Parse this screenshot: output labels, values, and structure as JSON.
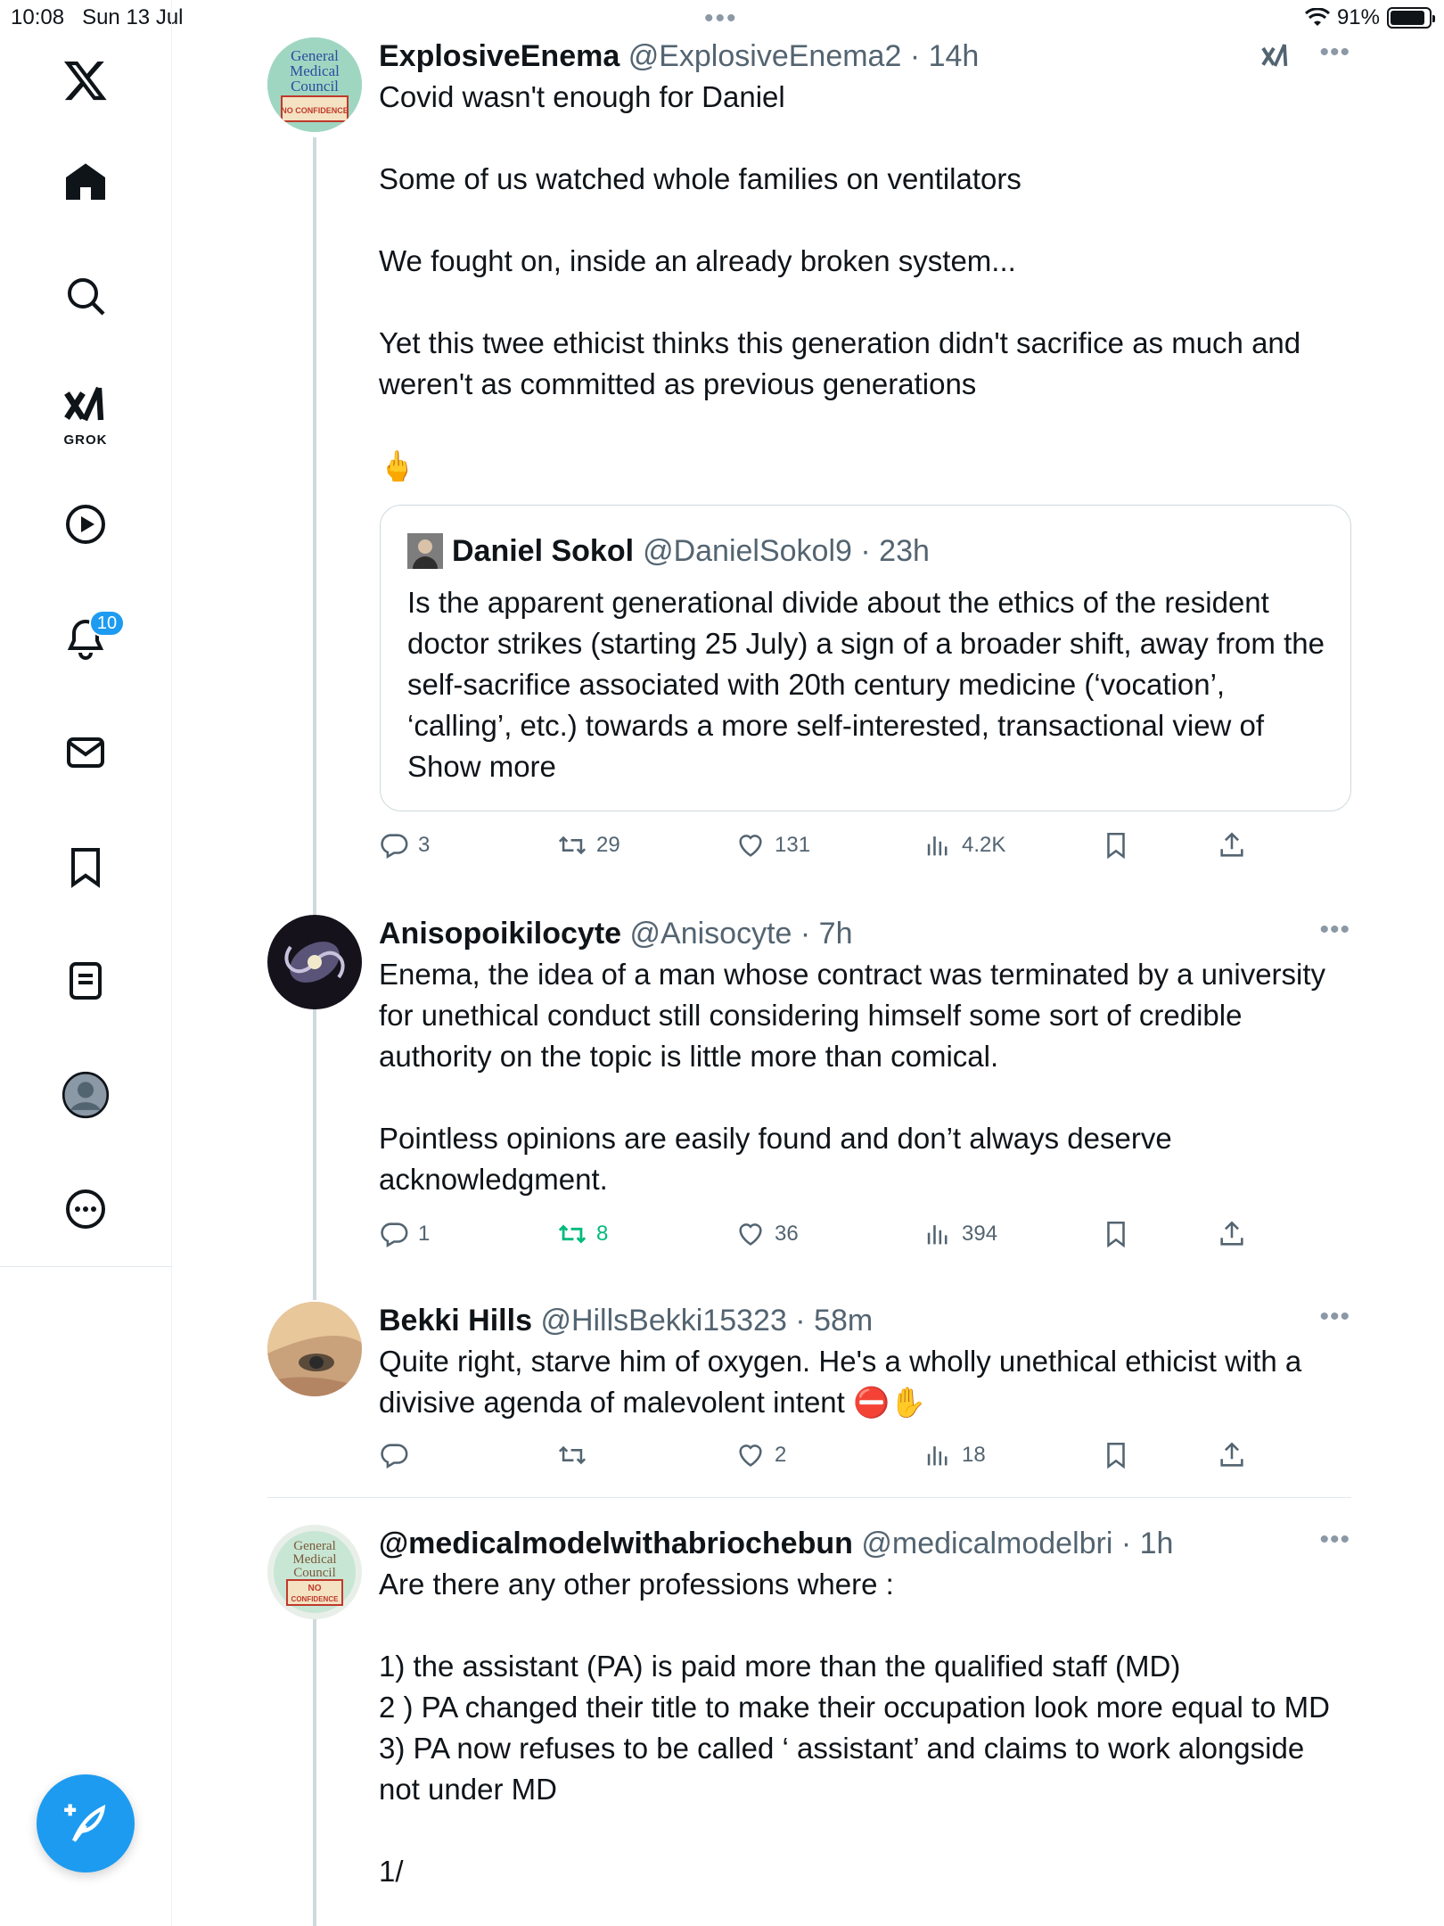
{
  "status_bar": {
    "time": "10:08",
    "date": "Sun 13 Jul",
    "battery": "91%"
  },
  "sidebar": {
    "items": [
      {
        "icon": "x-logo-icon"
      },
      {
        "icon": "home-icon"
      },
      {
        "icon": "search-icon"
      },
      {
        "icon": "grok-icon",
        "label": "GROK"
      },
      {
        "icon": "video-icon"
      },
      {
        "icon": "notifications-icon",
        "badge": "10"
      },
      {
        "icon": "messages-icon"
      },
      {
        "icon": "bookmarks-icon"
      },
      {
        "icon": "lists-icon"
      },
      {
        "icon": "profile-icon"
      },
      {
        "icon": "more-icon"
      }
    ],
    "compose_icon": "compose-icon"
  },
  "tweets": [
    {
      "name": "ExplosiveEnema",
      "handle": "@ExplosiveEnema2",
      "sep": " · ",
      "time": "14h",
      "avatar_text": [
        "General",
        "Medical",
        "Council",
        "NO CONFIDENCE"
      ],
      "text": "Covid wasn't enough for Daniel\n\nSome of us watched whole families on ventilators\n\nWe fought on, inside an already broken system...\n\nYet this twee ethicist thinks this generation didn't sacrifice as much and weren't as committed as previous generations\n\n🖕",
      "quote": {
        "name": "Daniel Sokol",
        "handle": "@DanielSokol9",
        "sep": " · ",
        "time": "23h",
        "text": "Is the apparent generational divide about the ethics of the resident doctor strikes (starting 25 July) a sign of a broader shift, away from the self-sacrifice associated with 20th century medicine (‘vocation’, ‘calling’, etc.) towards a more self-interested, transactional view of Show more"
      },
      "replies": "3",
      "reposts": "29",
      "likes": "131",
      "views": "4.2K"
    },
    {
      "name": "Anisopoikilocyte",
      "handle": "@Anisocyte",
      "sep": " · ",
      "time": "7h",
      "text": "Enema, the idea of a man whose contract was terminated by a university for unethical conduct still considering himself some sort of credible authority on the topic is little more than comical.\n\nPointless opinions are easily found and don’t always deserve acknowledgment.",
      "replies": "1",
      "reposts": "8",
      "likes": "36",
      "views": "394"
    },
    {
      "name": "Bekki Hills",
      "handle": "@HillsBekki15323",
      "sep": " · ",
      "time": "58m",
      "text": "Quite right, starve him of oxygen. He's a wholly unethical ethicist with a divisive agenda of malevolent intent ⛔✋",
      "replies": "",
      "reposts": "",
      "likes": "2",
      "views": "18"
    },
    {
      "name": "@medicalmodelwithabriochebun",
      "handle": "@medicalmodelbri",
      "sep": " · ",
      "time": "1h",
      "avatar_text": [
        "General",
        "Medical",
        "Council",
        "NO",
        "CONFIDENCE"
      ],
      "text": "Are there any other professions where :\n\n1) the assistant (PA) is paid more than the qualified staff (MD)\n2 ) PA changed their title to make their occupation look more equal to MD\n3) PA now refuses to be called ‘ assistant’ and claims to work alongside not under MD\n\n1/"
    }
  ],
  "colors": {
    "accent": "#1d9bf0",
    "text": "#0f1419",
    "secondary": "#536471",
    "repost_active": "#00ba7c",
    "border": "#cfd9de"
  }
}
